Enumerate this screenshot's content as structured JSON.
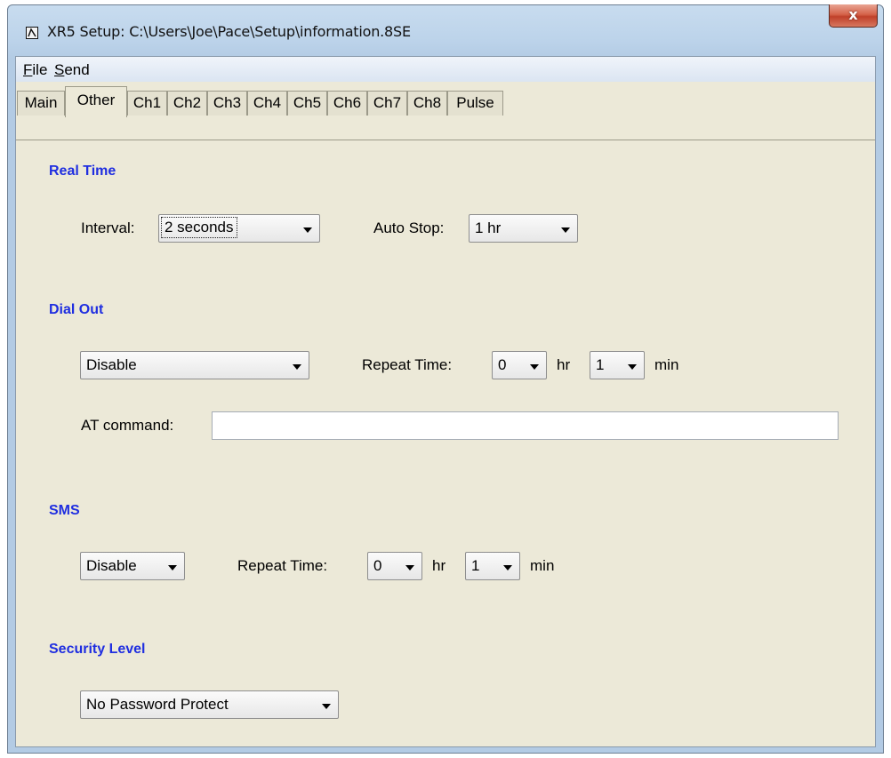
{
  "window": {
    "title": "XR5 Setup: C:\\Users\\Joe\\Pace\\Setup\\information.8SE",
    "close_glyph": "x"
  },
  "menubar": [
    {
      "mnemonic": "F",
      "rest": "ile"
    },
    {
      "mnemonic": "S",
      "rest": "end"
    }
  ],
  "tabs": [
    "Main",
    "Other",
    "Ch1",
    "Ch2",
    "Ch3",
    "Ch4",
    "Ch5",
    "Ch6",
    "Ch7",
    "Ch8",
    "Pulse"
  ],
  "active_tab": "Other",
  "real_time": {
    "title": "Real Time",
    "interval_label": "Interval:",
    "interval_value": "2 seconds",
    "auto_stop_label": "Auto Stop:",
    "auto_stop_value": "1 hr"
  },
  "dial_out": {
    "title": "Dial Out",
    "mode_value": "Disable",
    "repeat_label": "Repeat Time:",
    "hr_value": "0",
    "hr_unit": "hr",
    "min_value": "1",
    "min_unit": "min",
    "at_label": "AT command:",
    "at_value": ""
  },
  "sms": {
    "title": "SMS",
    "mode_value": "Disable",
    "repeat_label": "Repeat Time:",
    "hr_value": "0",
    "hr_unit": "hr",
    "min_value": "1",
    "min_unit": "min"
  },
  "security": {
    "title": "Security Level",
    "value": "No Password Protect"
  },
  "colors": {
    "section_title": "#1f2ee0",
    "panel_bg": "#ece9d8",
    "close_button": "#c8442c"
  }
}
